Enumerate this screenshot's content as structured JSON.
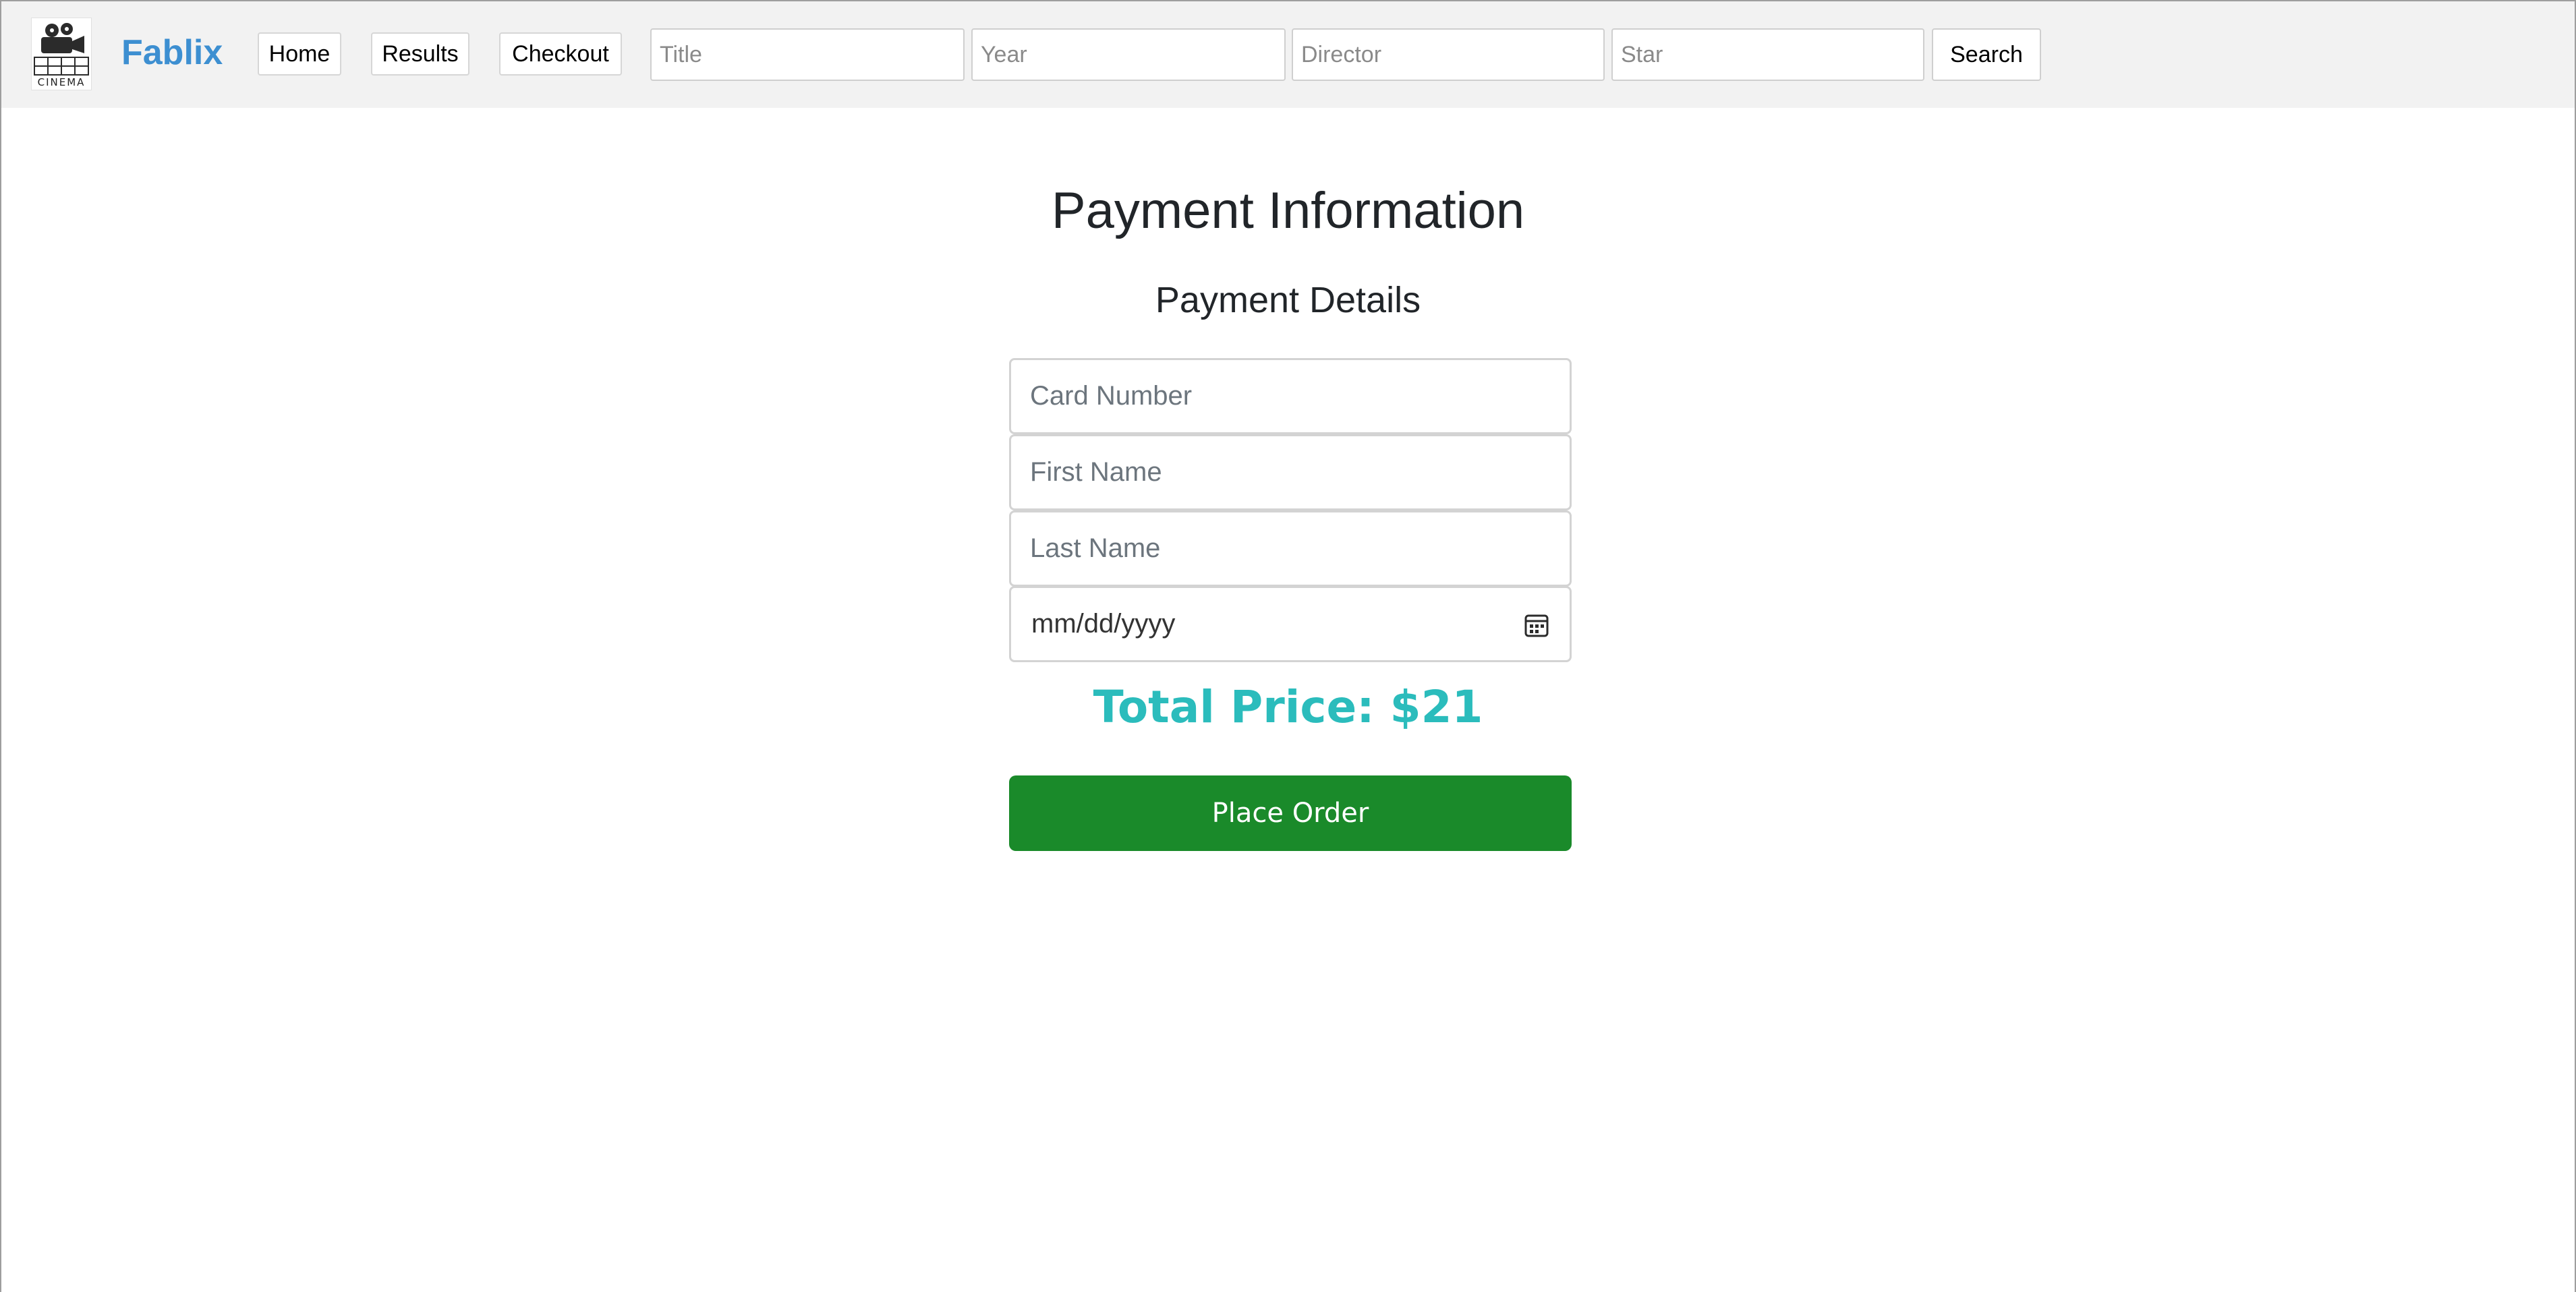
{
  "header": {
    "logo_caption": "CINEMA",
    "brand": "Fablix",
    "nav": {
      "home": "Home",
      "results": "Results",
      "checkout": "Checkout"
    },
    "search": {
      "title_placeholder": "Title",
      "year_placeholder": "Year",
      "director_placeholder": "Director",
      "star_placeholder": "Star",
      "button_label": "Search"
    }
  },
  "payment": {
    "title": "Payment Information",
    "subtitle": "Payment Details",
    "card_number_placeholder": "Card Number",
    "first_name_placeholder": "First Name",
    "last_name_placeholder": "Last Name",
    "expiration_placeholder": "mm/dd/yyyy",
    "total_price": "Total Price: $21",
    "place_order_label": "Place Order"
  },
  "colors": {
    "brand": "#3d8fd1",
    "total_price": "#2bbcbc",
    "place_order_button": "#1a8a2a",
    "navbar_background": "#f2f2f2"
  },
  "icons": {
    "logo": "film-camera-icon",
    "date_picker": "calendar-icon"
  }
}
